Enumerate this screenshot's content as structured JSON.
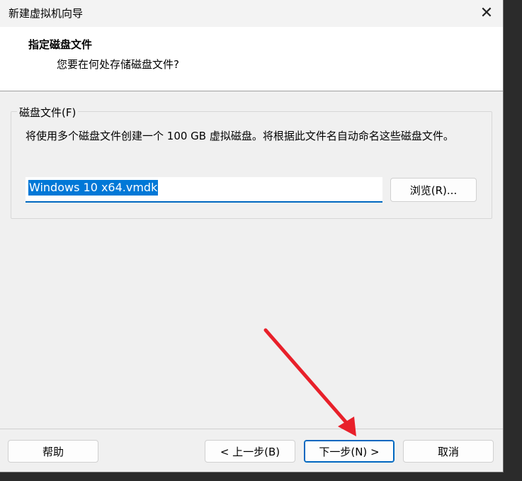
{
  "window": {
    "title": "新建虚拟机向导",
    "close_glyph": "✕"
  },
  "header": {
    "title": "指定磁盘文件",
    "subtitle": "您要在何处存储磁盘文件?"
  },
  "disk_group": {
    "legend": "磁盘文件(F)",
    "description": "将使用多个磁盘文件创建一个 100 GB 虚拟磁盘。将根据此文件名自动命名这些磁盘文件。",
    "file_value": "Windows 10 x64.vmdk",
    "browse_label": "浏览(R)..."
  },
  "footer": {
    "help_label": "帮助",
    "back_label": "< 上一步(B)",
    "next_label": "下一步(N) >",
    "cancel_label": "取消"
  },
  "annotation": {
    "arrow_color": "#e8202a"
  }
}
